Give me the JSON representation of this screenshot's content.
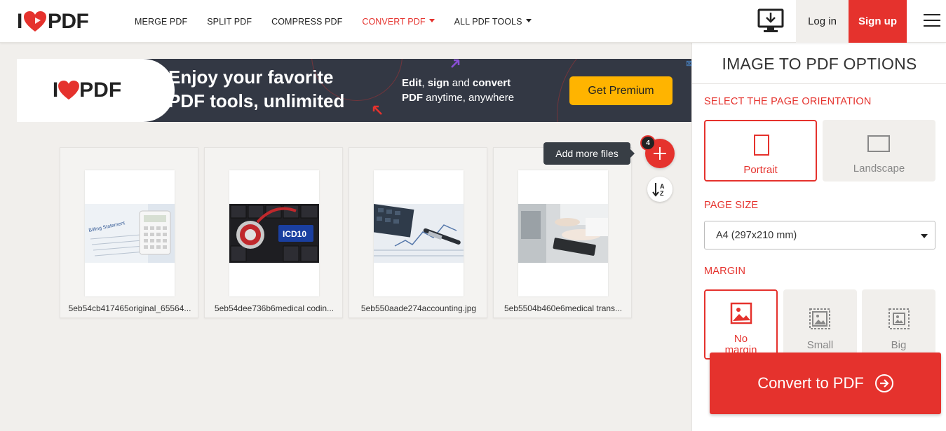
{
  "header": {
    "logo_text": "PDF",
    "logo_i": "I",
    "nav": [
      {
        "label": "MERGE PDF",
        "active": false
      },
      {
        "label": "SPLIT PDF",
        "active": false
      },
      {
        "label": "COMPRESS PDF",
        "active": false
      },
      {
        "label": "CONVERT PDF",
        "active": true
      },
      {
        "label": "ALL PDF TOOLS",
        "active": false
      }
    ],
    "login_label": "Log in",
    "signup_label": "Sign up",
    "desktop_icon": "desktop-download-icon",
    "menu_icon": "hamburger-menu-icon"
  },
  "ad": {
    "logo_text": "PDF",
    "logo_i": "I",
    "headline_1": "Enjoy your favorite",
    "headline_2": "PDF tools, unlimited",
    "sub_b1": "Edit",
    "sub_c1": ", ",
    "sub_b2": "sign",
    "sub_c2": " and ",
    "sub_b3": "convert",
    "sub_b4": "PDF",
    "sub_c3": " anytime, anywhere",
    "cta_label": "Get Premium",
    "close_glyph": "⊠"
  },
  "files": [
    {
      "name": "5eb54cb417465original_65564..."
    },
    {
      "name": "5eb54dee736b6medical codin..."
    },
    {
      "name": "5eb550aade274accounting.jpg"
    },
    {
      "name": "5eb5504b460e6medical trans..."
    }
  ],
  "add_files": {
    "tooltip": "Add more files",
    "count": "4"
  },
  "sort_icon": "sort-alpha-icon",
  "panel": {
    "title": "IMAGE TO PDF OPTIONS",
    "orientation_label": "SELECT THE PAGE ORIENTATION",
    "orientation": {
      "portrait": "Portrait",
      "landscape": "Landscape",
      "selected": "Portrait"
    },
    "page_size_label": "PAGE SIZE",
    "page_size_value": "A4 (297x210 mm)",
    "margin_label": "MARGIN",
    "margin": {
      "no_margin_1": "No",
      "no_margin_2": "margin",
      "small": "Small",
      "big": "Big",
      "selected": "No margin"
    },
    "convert_label": "Convert to PDF"
  },
  "colors": {
    "brand_red": "#e5322d",
    "ad_bg": "#333844",
    "cta_yellow": "#ffb400"
  }
}
